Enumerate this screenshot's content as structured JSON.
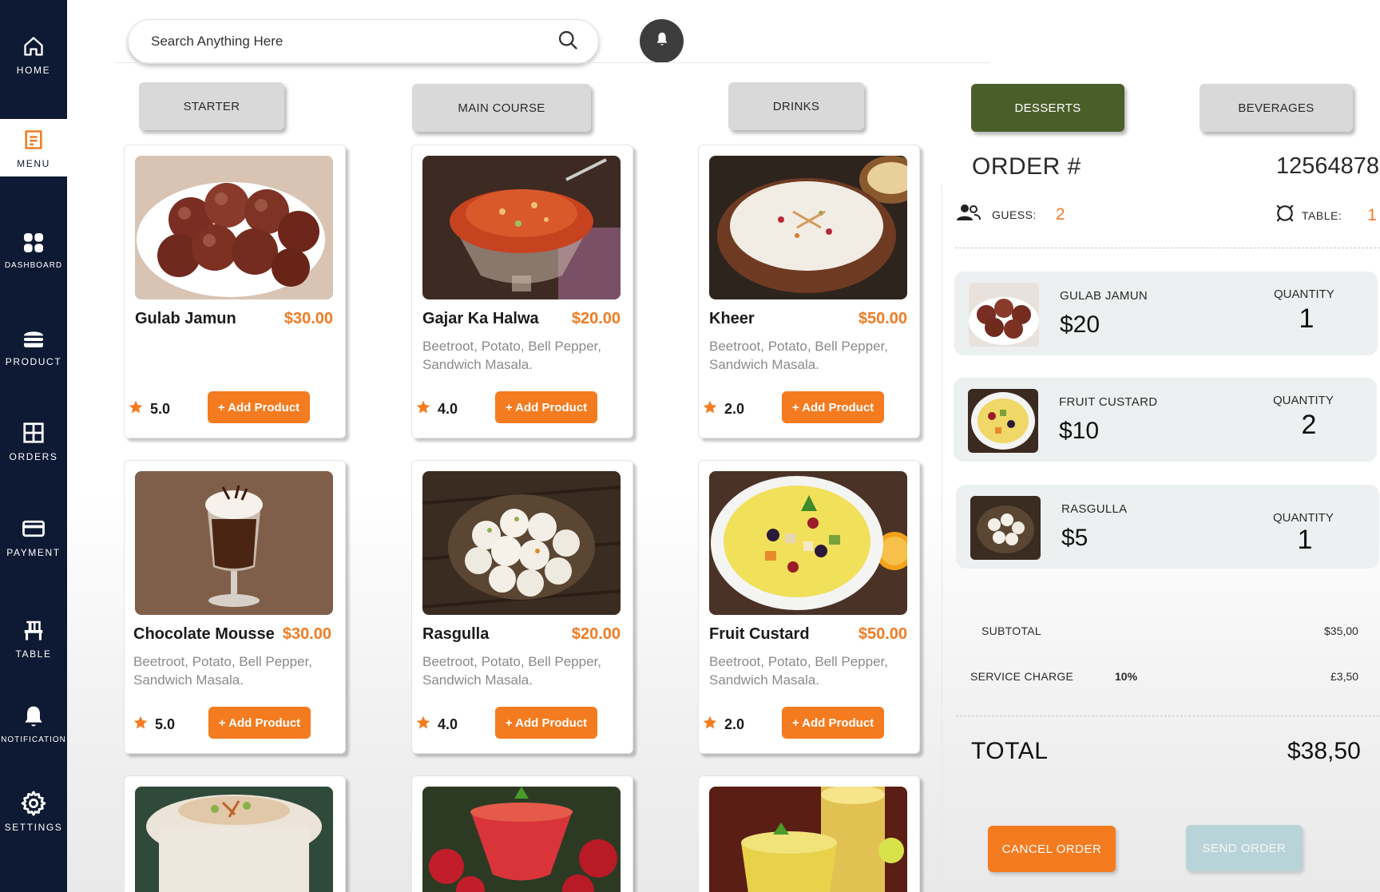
{
  "sidebar": {
    "items": [
      {
        "label": "HOME",
        "icon": "home-icon"
      },
      {
        "label": "MENU",
        "icon": "menu-icon",
        "active": true
      },
      {
        "label": "DASHBOARD",
        "icon": "dashboard-icon"
      },
      {
        "label": "PRODUCT",
        "icon": "burger-icon"
      },
      {
        "label": "ORDERS",
        "icon": "grid-icon"
      },
      {
        "label": "PAYMENT",
        "icon": "card-icon"
      },
      {
        "label": "TABLE",
        "icon": "chair-icon"
      },
      {
        "label": "NOTIFICATION",
        "icon": "bell-icon"
      },
      {
        "label": "SETTINGS",
        "icon": "gear-icon"
      }
    ],
    "colors": {
      "background": "#0e1a33",
      "active": "#f07c24"
    }
  },
  "search": {
    "placeholder": "Search Anything Here"
  },
  "categories": [
    "STARTER",
    "MAIN COURSE",
    "DRINKS",
    "DESSERTS",
    "BEVERAGES"
  ],
  "active_category": "DESSERTS",
  "products": [
    {
      "name": "Gulab Jamun",
      "price": "$30.00",
      "desc": "",
      "rating": "5.0",
      "add": "+ Add Product"
    },
    {
      "name": "Gajar Ka Halwa",
      "price": "$20.00",
      "desc": "Beetroot, Potato, Bell Pepper, Sandwich Masala.",
      "rating": "4.0",
      "add": "+ Add Product"
    },
    {
      "name": "Kheer",
      "price": "$50.00",
      "desc": "Beetroot, Potato, Bell Pepper, Sandwich Masala.",
      "rating": "2.0",
      "add": "+ Add Product"
    },
    {
      "name": "Chocolate Mousse",
      "price": "$30.00",
      "desc": "Beetroot, Potato, Bell Pepper, Sandwich Masala.",
      "rating": "5.0",
      "add": "+ Add Product"
    },
    {
      "name": "Rasgulla",
      "price": "$20.00",
      "desc": "Beetroot, Potato, Bell Pepper, Sandwich Masala.",
      "rating": "4.0",
      "add": "+ Add Product"
    },
    {
      "name": "Fruit Custard",
      "price": "$50.00",
      "desc": "Beetroot, Potato, Bell Pepper, Sandwich Masala.",
      "rating": "2.0",
      "add": "+ Add Product"
    }
  ],
  "order": {
    "title": "ORDER #",
    "number": "12564878",
    "guest_label": "GUESS:",
    "guest_count": "2",
    "table_label": "TABLE:",
    "table_number": "1",
    "items": [
      {
        "name": "GULAB JAMUN",
        "price": "$20",
        "qty_label": "QUANTITY",
        "qty": "1"
      },
      {
        "name": "FRUIT CUSTARD",
        "price": "$10",
        "qty_label": "QUANTITY",
        "qty": "2"
      },
      {
        "name": "RASGULLA",
        "price": "$5",
        "qty_label": "QUANTITY",
        "qty": "1"
      }
    ],
    "subtotal_label": "SUBTOTAL",
    "subtotal": "$35,00",
    "service_label": "SERVICE CHARGE",
    "service_pct": "10%",
    "service_amount": "£3,50",
    "total_label": "TOTAL",
    "total": "$38,50",
    "cancel_label": "CANCEL ORDER",
    "send_label": "SEND  ORDER"
  },
  "colors": {
    "accent": "#f47b20",
    "active_tab": "#4a5e2a",
    "send_disabled": "#b9d4d8"
  }
}
